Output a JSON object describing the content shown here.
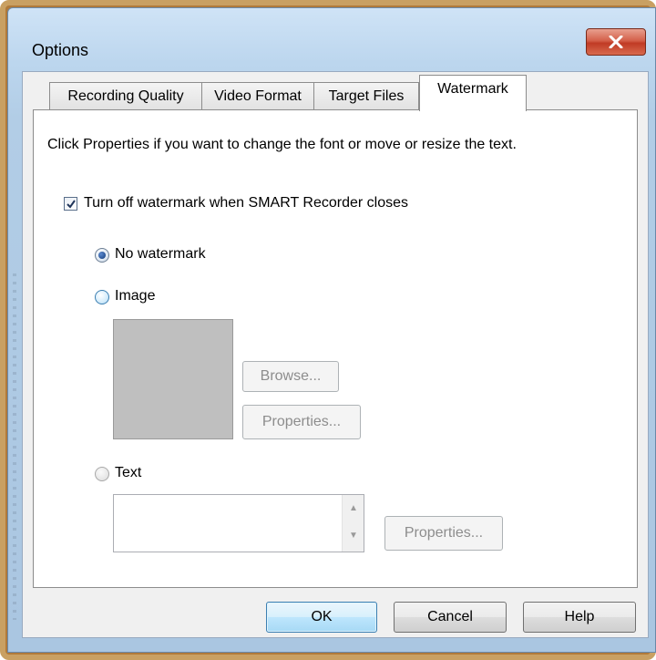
{
  "window": {
    "title": "Options",
    "close_icon": "close-x-icon"
  },
  "tabs": [
    {
      "label": "Recording Quality",
      "active": false
    },
    {
      "label": "Video Format",
      "active": false
    },
    {
      "label": "Target Files",
      "active": false
    },
    {
      "label": "Watermark",
      "active": true
    }
  ],
  "panel": {
    "instructions": "Click Properties if you want to change the font or move or resize the text.",
    "turn_off_checkbox": {
      "label": "Turn off watermark when SMART Recorder closes",
      "checked": true
    },
    "options": {
      "no_watermark": {
        "label": "No watermark",
        "selected": true
      },
      "image": {
        "label": "Image",
        "selected": false
      },
      "text": {
        "label": "Text",
        "selected": false
      }
    },
    "image_buttons": {
      "browse": "Browse...",
      "properties": "Properties..."
    },
    "text_properties": "Properties..."
  },
  "footer": {
    "ok": "OK",
    "cancel": "Cancel",
    "help": "Help"
  }
}
